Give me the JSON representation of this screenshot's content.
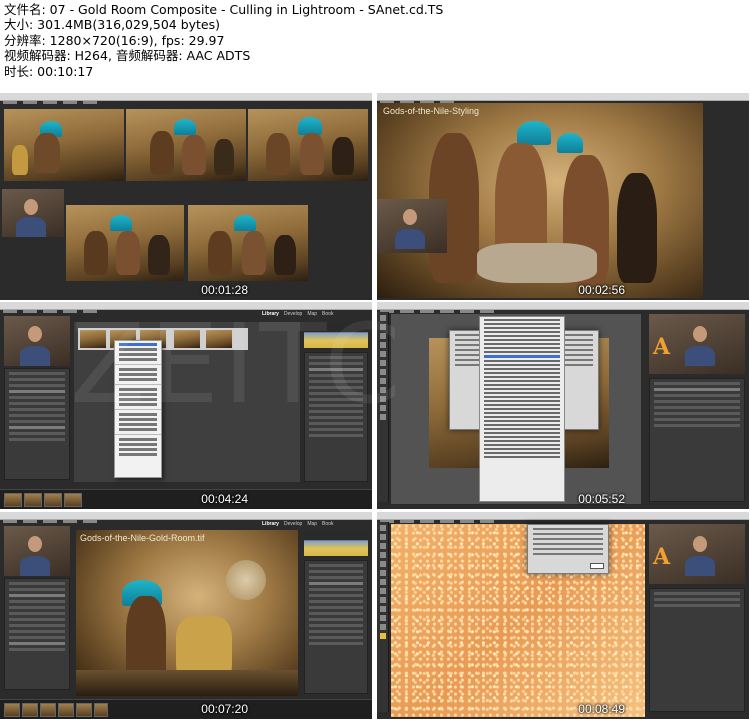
{
  "header": {
    "file_name": "文件名: 07 - Gold Room Composite - Culling in Lightroom - SAnet.cd.TS",
    "size": "大小: 301.4MB(316,029,504 bytes)",
    "resolution": "分辨率: 1280×720(16:9), fps: 29.97",
    "codec": "视频解码器: H264, 音频解码器: AAC ADTS",
    "duration": "时长: 00:10:17"
  },
  "watermark": "ZEITC",
  "frames": [
    {
      "timestamp": "00:01:28",
      "app": "Lightroom"
    },
    {
      "timestamp": "00:02:56",
      "app": "Lightroom",
      "image_title": "Gods-of-the-Nile-Styling"
    },
    {
      "timestamp": "00:04:24",
      "app": "Lightroom"
    },
    {
      "timestamp": "00:05:52",
      "app": "Photoshop"
    },
    {
      "timestamp": "00:07:20",
      "app": "Lightroom",
      "image_title": "Gods-of-the-Nile-Gold-Room.tif"
    },
    {
      "timestamp": "00:08:49",
      "app": "Photoshop"
    }
  ],
  "colors": {
    "lr_bg": "#2b2b2b",
    "gold": "#b7935b",
    "teal": "#1fb5c9",
    "highlight": "#3f6fd0"
  }
}
